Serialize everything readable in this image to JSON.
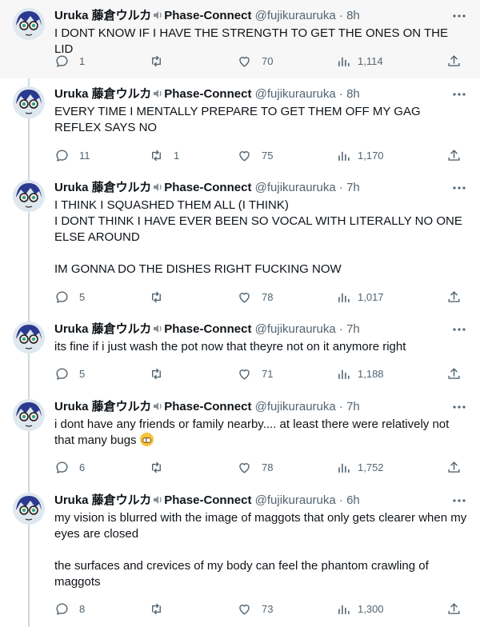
{
  "colors": {
    "accent": "#1d9bf0",
    "muted": "#536471",
    "text": "#0f1419",
    "thread_line": "#cfd9de"
  },
  "tweets": [
    {
      "name": "Uruka 藤倉ウルカ",
      "name_suffix": "Phase-Connect",
      "handle": "@fujikurauruka",
      "sep": "·",
      "time": "8h",
      "text": "I DONT KNOW IF I HAVE THE STRENGTH TO GET THE ONES ON THE LID",
      "replies": "1",
      "retweets": "",
      "likes": "70",
      "views": "1,114"
    },
    {
      "name": "Uruka 藤倉ウルカ",
      "name_suffix": "Phase-Connect",
      "handle": "@fujikurauruka",
      "sep": "·",
      "time": "8h",
      "text": "EVERY TIME I MENTALLY PREPARE TO GET THEM OFF MY GAG REFLEX SAYS NO",
      "replies": "11",
      "retweets": "1",
      "likes": "75",
      "views": "1,170"
    },
    {
      "name": "Uruka 藤倉ウルカ",
      "name_suffix": "Phase-Connect",
      "handle": "@fujikurauruka",
      "sep": "·",
      "time": "7h",
      "text": "I THINK I SQUASHED THEM ALL (I THINK)\nI DONT THINK I HAVE EVER BEEN SO VOCAL WITH LITERALLY NO ONE ELSE AROUND\n\nIM GONNA DO THE DISHES RIGHT FUCKING NOW",
      "replies": "5",
      "retweets": "",
      "likes": "78",
      "views": "1,017"
    },
    {
      "name": "Uruka 藤倉ウルカ",
      "name_suffix": "Phase-Connect",
      "handle": "@fujikurauruka",
      "sep": "·",
      "time": "7h",
      "text": "its fine if i just wash the pot now that theyre not on it anymore right",
      "replies": "5",
      "retweets": "",
      "likes": "71",
      "views": "1,188"
    },
    {
      "name": "Uruka 藤倉ウルカ",
      "name_suffix": "Phase-Connect",
      "handle": "@fujikurauruka",
      "sep": "·",
      "time": "7h",
      "text": "i dont have any friends or family nearby.... at least there were relatively not that many bugs ",
      "emoji": "pleading-face-emoji",
      "replies": "6",
      "retweets": "",
      "likes": "78",
      "views": "1,752"
    },
    {
      "name": "Uruka 藤倉ウルカ",
      "name_suffix": "Phase-Connect",
      "handle": "@fujikurauruka",
      "sep": "·",
      "time": "6h",
      "text": "my vision is blurred with the image of maggots that only gets clearer when my eyes are closed\n\nthe surfaces and crevices of my body can feel the phantom crawling of maggots",
      "replies": "8",
      "retweets": "",
      "likes": "73",
      "views": "1,300"
    }
  ]
}
